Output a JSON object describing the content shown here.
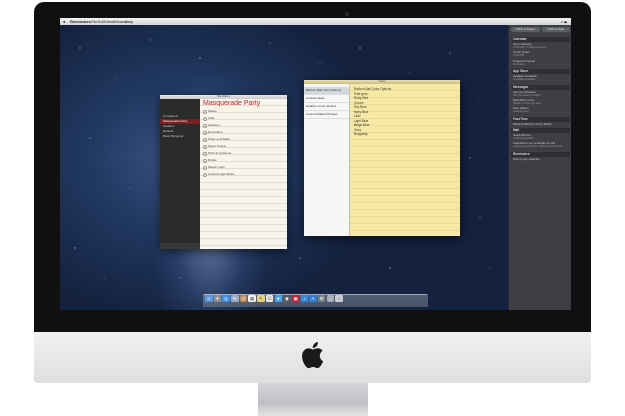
{
  "menubar": {
    "app_menus": [
      "Reminders",
      "File",
      "Edit",
      "View",
      "Window",
      "Help"
    ],
    "status": "⌕ ☰"
  },
  "notification_center": {
    "buttons": [
      "Click to Tweet",
      "Click to Post"
    ],
    "sections": [
      {
        "title": "Calendar",
        "items": [
          {
            "title": "Team Meeting",
            "sub": "10:00 AM, Conference Room"
          },
          {
            "title": "Lunch Order",
            "sub": "12:00 PM"
          },
          {
            "title": "Project Proposal",
            "sub": "Due today"
          }
        ]
      },
      {
        "title": "App Store",
        "items": [
          {
            "title": "Updates Available",
            "sub": "5 updates available"
          }
        ]
      },
      {
        "title": "Messages",
        "items": [
          {
            "title": "Jeremy Schwarm",
            "sub": "Are you coming tonight?"
          },
          {
            "title": "Meredith Lovett",
            "sub": "Thanks, I'll see you soon"
          },
          {
            "title": "Kate Wilson",
            "sub": "Sounds great"
          }
        ]
      },
      {
        "title": "FaceTime",
        "items": [
          {
            "title": "Missed call from Aaron Baker",
            "sub": ""
          }
        ]
      },
      {
        "title": "Mail",
        "items": [
          {
            "title": "Susan Brown",
            "sub": "Conference Plans"
          },
          {
            "title": "Attached is our schedule for the",
            "sub": "upcoming conference. Please let me know"
          }
        ]
      },
      {
        "title": "Reminders",
        "items": [
          {
            "title": "Pick up dry cleaning",
            "sub": ""
          }
        ]
      }
    ]
  },
  "reminders": {
    "window_title": "Reminders",
    "lists": [
      "Completed",
      "Masquerade Party",
      "Vacation",
      "Errands",
      "Book Shopping"
    ],
    "selected_list": "Masquerade Party",
    "heading": "Masquerade Party",
    "items": [
      "Masks",
      "Gifts",
      "Feathers",
      "Decoration",
      "Chips and Salsa",
      "Paper Towels",
      "Pick Up Costume",
      "Drinks",
      "Plastic Cups",
      "Colored Light Bulbs"
    ]
  },
  "notes": {
    "window_title": "Notes",
    "list": [
      "Balloon Ball Color Options",
      "Contest Ideas",
      "Healthy Lunch Options",
      "Colored Salted Phrases"
    ],
    "body_lines": [
      "Balloon Ball Color Options",
      "Pale grey",
      "Ruby Red",
      "Cream",
      "Sky Blue",
      "Navy Blue",
      "Lilac",
      "Light Blue",
      "Beige Blue",
      "Grey",
      "Burgundy"
    ]
  },
  "dock": {
    "icons": [
      {
        "name": "finder-icon",
        "color": "#5b9ae0",
        "glyph": "☺"
      },
      {
        "name": "launchpad-icon",
        "color": "#8d8f96",
        "glyph": "✈"
      },
      {
        "name": "safari-icon",
        "color": "#3f8fe0",
        "glyph": "◎"
      },
      {
        "name": "mail-icon",
        "color": "#9aa9c4",
        "glyph": "✉"
      },
      {
        "name": "contacts-icon",
        "color": "#b88a55",
        "glyph": "@"
      },
      {
        "name": "calendar-icon",
        "color": "#f4f4f4",
        "glyph": "▦"
      },
      {
        "name": "notes-icon",
        "color": "#e7d57c",
        "glyph": "✎"
      },
      {
        "name": "reminders-icon",
        "color": "#e9e9e9",
        "glyph": "☑"
      },
      {
        "name": "messages-icon",
        "color": "#4aa6e8",
        "glyph": "●"
      },
      {
        "name": "facetime-icon",
        "color": "#555b63",
        "glyph": "◉"
      },
      {
        "name": "photo-booth-icon",
        "color": "#c8202a",
        "glyph": "▣"
      },
      {
        "name": "itunes-icon",
        "color": "#3b8ad8",
        "glyph": "♪"
      },
      {
        "name": "app-store-icon",
        "color": "#2d7fd8",
        "glyph": "A"
      },
      {
        "name": "system-preferences-icon",
        "color": "#7a7d84",
        "glyph": "⚙"
      },
      {
        "name": "downloads-icon",
        "color": "#a7adb8",
        "glyph": "↓"
      },
      {
        "name": "trash-icon",
        "color": "#c9ccd2",
        "glyph": "⌂"
      }
    ]
  },
  "colors": {
    "bezel": "#101012",
    "chin": "#e8e9eb",
    "reminders_accent": "#b3262d"
  }
}
